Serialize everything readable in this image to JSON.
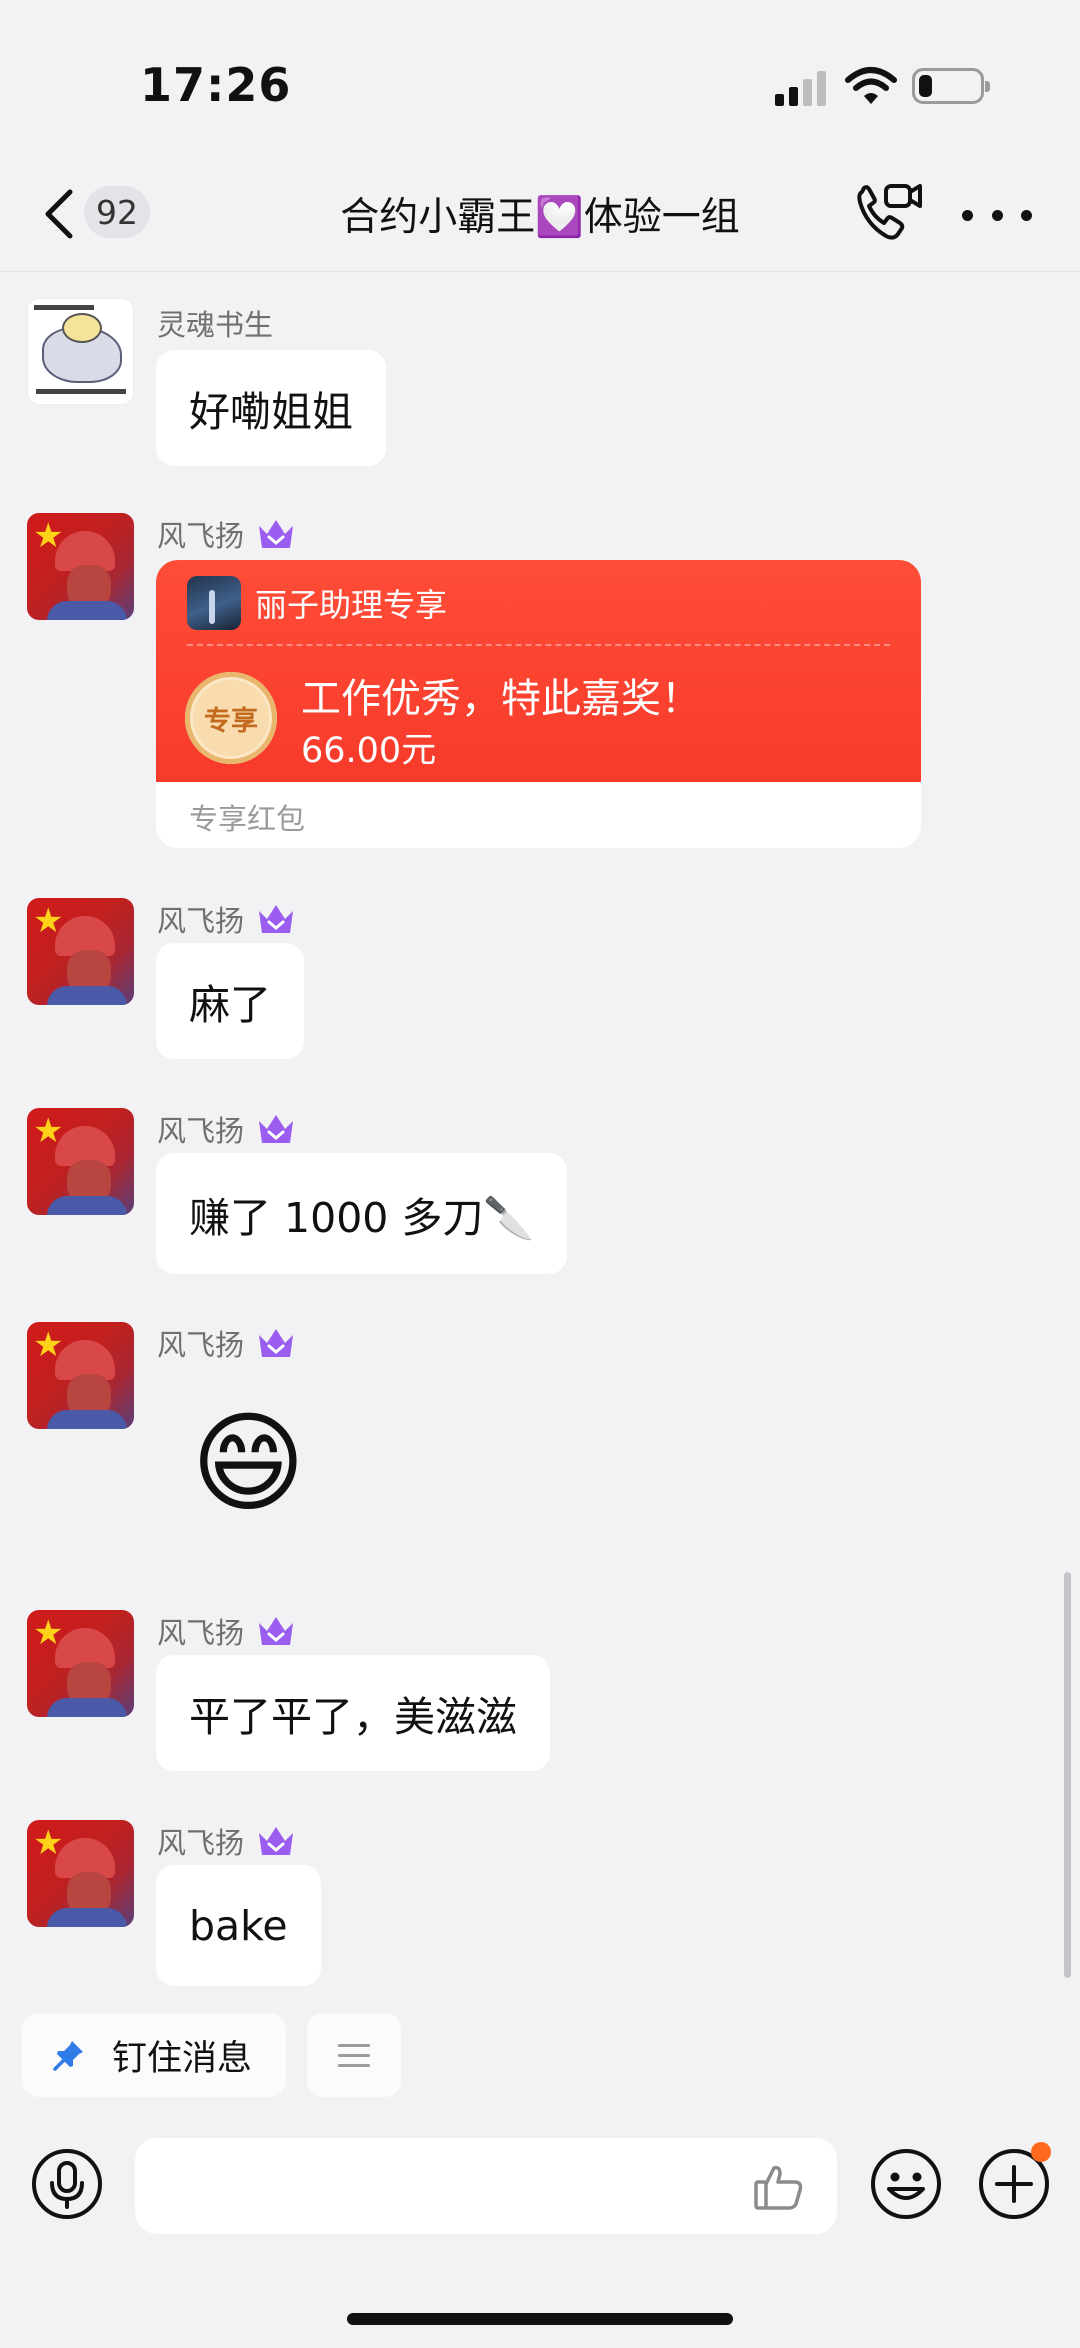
{
  "status_bar": {
    "time": "17:26",
    "battery_level": 0.22
  },
  "header": {
    "unread_count": "92",
    "title": "合约小霸王💟体验一组"
  },
  "messages": [
    {
      "sender": "灵魂书生",
      "text": "好嘞姐姐"
    },
    {
      "sender": "风飞扬",
      "red_packet": {
        "source": "丽子助理专享",
        "seal": "专享",
        "greeting": "工作优秀，特此嘉奖！",
        "amount": "66.00元",
        "type_label": "专享红包"
      }
    },
    {
      "sender": "风飞扬",
      "text": "麻了"
    },
    {
      "sender": "风飞扬",
      "text": "赚了 1000 多刀🔪"
    },
    {
      "sender": "风飞扬",
      "emoji": "😄"
    },
    {
      "sender": "风飞扬",
      "text": "平了平了，美滋滋"
    },
    {
      "sender": "风飞扬",
      "text": "bake"
    }
  ],
  "pin_bar": {
    "label": "钉住消息"
  },
  "input_bar": {
    "value": "",
    "placeholder": ""
  },
  "colors": {
    "background": "#f2f2f4",
    "red_packet": "#f73a2a",
    "vip_crown": "#9b5cf0",
    "pin_icon": "#2f7be8",
    "notification_dot": "#ff6a1f"
  }
}
